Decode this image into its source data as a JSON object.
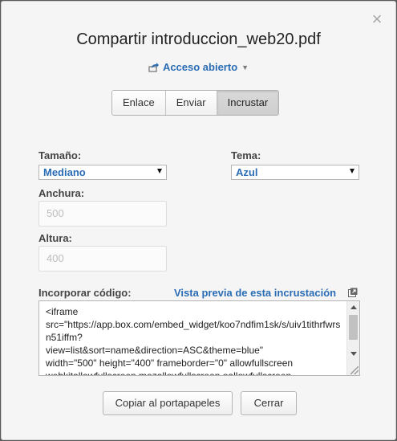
{
  "dialog": {
    "title": "Compartir introduccion_web20.pdf",
    "close_symbol": "×",
    "access": {
      "label": "Acceso abierto",
      "icon": "share-icon"
    }
  },
  "tabs": [
    {
      "label": "Enlace",
      "active": false
    },
    {
      "label": "Enviar",
      "active": false
    },
    {
      "label": "Incrustar",
      "active": true
    }
  ],
  "form": {
    "size_label": "Tamaño:",
    "size_value": "Mediano",
    "theme_label": "Tema:",
    "theme_value": "Azul",
    "width_label": "Anchura:",
    "width_placeholder": "500",
    "height_label": "Altura:",
    "height_placeholder": "400",
    "embed_label": "Incorporar código:",
    "preview_link": "Vista previa de esta incrustación",
    "embed_code": "<iframe\nsrc=\"https://app.box.com/embed_widget/koo7ndfim1sk/s/uiv1tithrfwrsn51iffm?\nview=list&sort=name&direction=ASC&theme=blue\"\nwidth=\"500\" height=\"400\" frameborder=\"0\" allowfullscreen\nwebkitallowfullscreen mozallowfullscreen oallowfullscreen"
  },
  "buttons": {
    "copy": "Copiar al portapapeles",
    "close": "Cerrar"
  },
  "colors": {
    "accent": "#2a6db5",
    "dialog_bg": "#f5f5f5"
  }
}
